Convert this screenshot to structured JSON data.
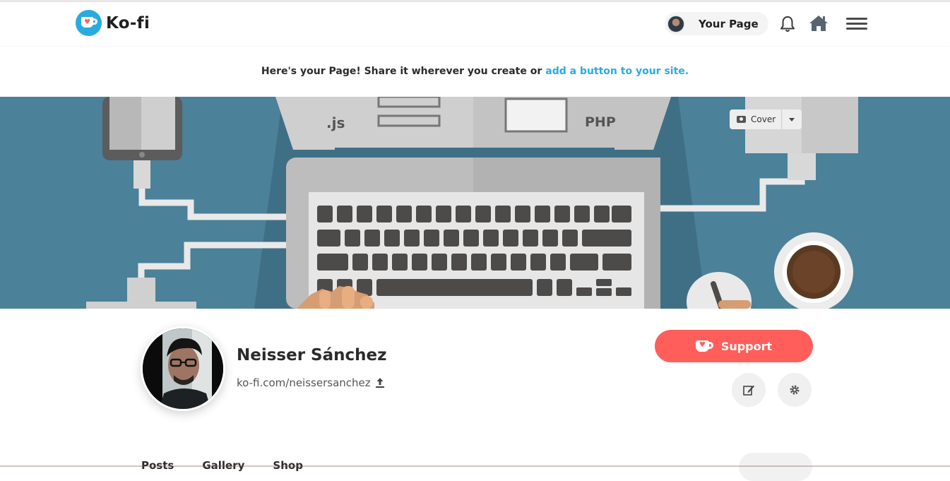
{
  "header": {
    "brand": "Ko-fi",
    "your_page_label": "Your Page"
  },
  "notice": {
    "text": "Here's your Page! Share it wherever you create or",
    "link_text": "add a button to your site."
  },
  "cover": {
    "button_label": "Cover",
    "labels": {
      "js": ".js",
      "php": "PHP"
    }
  },
  "profile": {
    "name": "Neisser Sánchez",
    "url": "ko-fi.com/neissersanchez"
  },
  "actions": {
    "support_label": "Support"
  },
  "bottom": {
    "tabs": [
      "Posts",
      "Gallery",
      "Shop"
    ]
  },
  "colors": {
    "brand_blue": "#29abe0",
    "support_red": "#ff5e5b",
    "cover_bg": "#4b8199"
  },
  "icons": [
    "kofi-cup-icon",
    "bell-icon",
    "home-icon",
    "hamburger-menu-icon",
    "camera-icon",
    "caret-down-icon",
    "share-upload-icon",
    "edit-icon",
    "gear-icon"
  ]
}
